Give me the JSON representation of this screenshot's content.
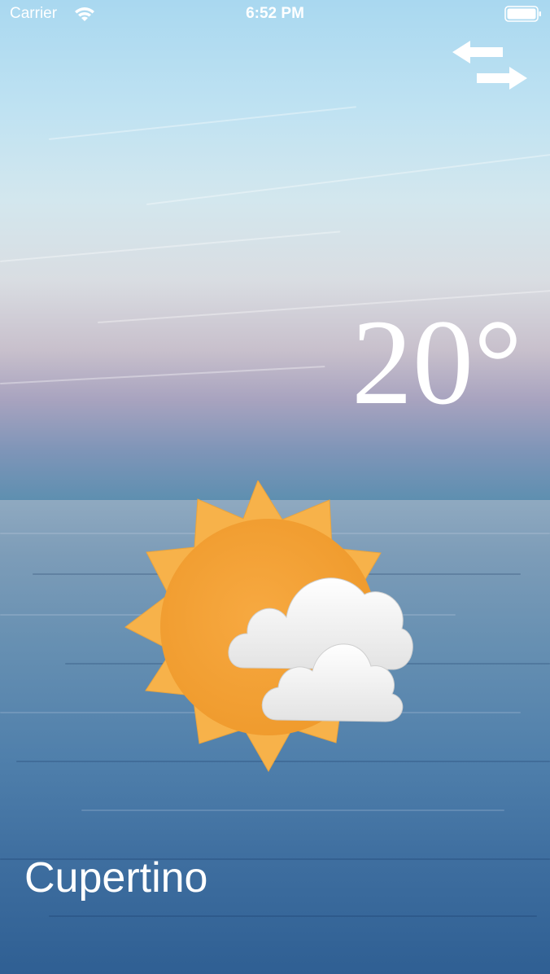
{
  "status_bar": {
    "carrier": "Carrier",
    "time": "6:52 PM",
    "wifi_icon": "wifi-icon",
    "battery_icon": "battery-full-icon"
  },
  "toolbar": {
    "swap_icon": "swap-arrows-icon"
  },
  "weather": {
    "temperature": "20°",
    "condition_icon": "sun-behind-clouds-icon",
    "city": "Cupertino"
  },
  "colors": {
    "sky_top": "#a9d8f0",
    "sky_horizon": "#a8a3bf",
    "sea": "#4f7fab",
    "sun": "#f7b24a",
    "sun_core": "#f2a23a",
    "cloud": "#f4f4f4",
    "text": "#ffffff"
  }
}
